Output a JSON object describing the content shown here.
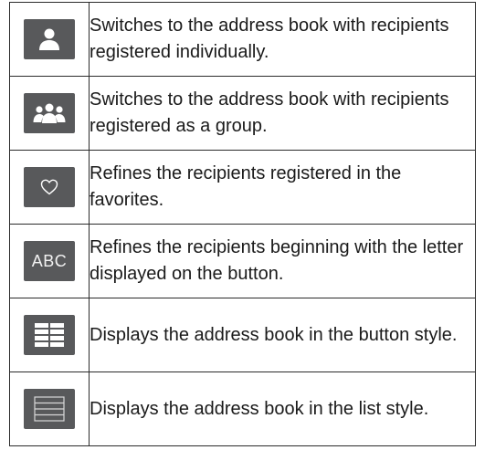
{
  "rows": [
    {
      "icon": "person-icon",
      "description": "Switches to the address book with recipients registered individually."
    },
    {
      "icon": "group-icon",
      "description": "Switches to the address book with recipients registered as a group."
    },
    {
      "icon": "heart-icon",
      "description": "Refines the recipients registered in the favorites."
    },
    {
      "icon": "abc-icon",
      "icon_text": "ABC",
      "description": "Refines the recipients beginning with the letter displayed on the button."
    },
    {
      "icon": "button-style-grid-icon",
      "description": "Displays the address book in the button style."
    },
    {
      "icon": "list-style-icon",
      "description": "Displays the address book in the list style."
    }
  ]
}
